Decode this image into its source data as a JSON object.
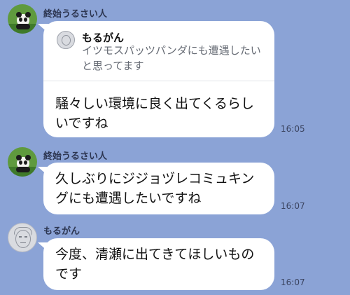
{
  "messages": [
    {
      "sender": "終始うるさい人",
      "avatar": "panda-avatar",
      "reply": {
        "name": "もるがん",
        "text": "イツモスパッツパンダにも遭遇したいと思ってます"
      },
      "text": "騒々しい環境に良く出てくるらしいですね",
      "time": "16:05"
    },
    {
      "sender": "終始うるさい人",
      "avatar": "panda-avatar",
      "text": "久しぶりにジジョヅレコミュキングにも遭遇したいですね",
      "time": "16:07"
    },
    {
      "sender": "もるがん",
      "avatar": "sketch-avatar",
      "text": "今度、清瀬に出てきてほしいものです",
      "time": "16:07"
    }
  ],
  "colors": {
    "background": "#8ba3d6",
    "bubble": "#ffffff",
    "sender_text": "#2c3550"
  }
}
